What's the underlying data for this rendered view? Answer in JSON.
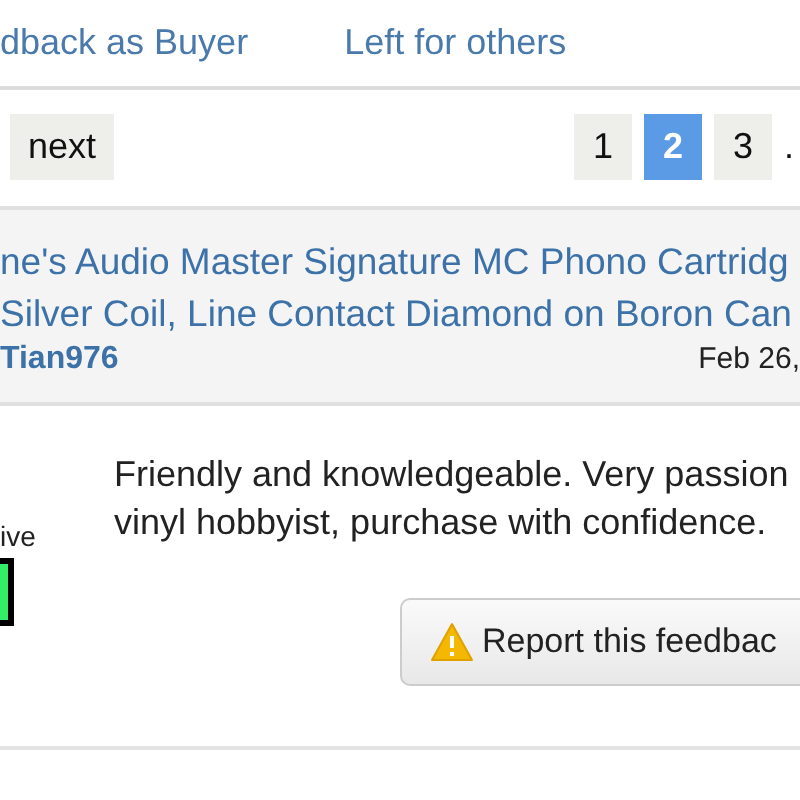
{
  "tabs": [
    {
      "label": "dback as Buyer",
      "selected": false
    },
    {
      "label": "Left for others",
      "selected": false
    }
  ],
  "pagination": {
    "next": "next",
    "pages": [
      {
        "label": "1",
        "selected": false
      },
      {
        "label": "2",
        "selected": true
      },
      {
        "label": "3",
        "selected": false
      }
    ],
    "more": "."
  },
  "listing": {
    "title_lines": [
      "ne's Audio Master Signature MC Phono Cartridg",
      "Silver Coil, Line Contact Diamond on Boron Can"
    ],
    "user": "Tian976",
    "date": "Feb 26,"
  },
  "feedback": {
    "rating_label": "ive",
    "rating_positive": true,
    "comment": "Friendly and knowledgeable. Very passion",
    "comment_line_2": "vinyl hobbyist, purchase with confidence.",
    "report_button": "Report this feedbac"
  }
}
